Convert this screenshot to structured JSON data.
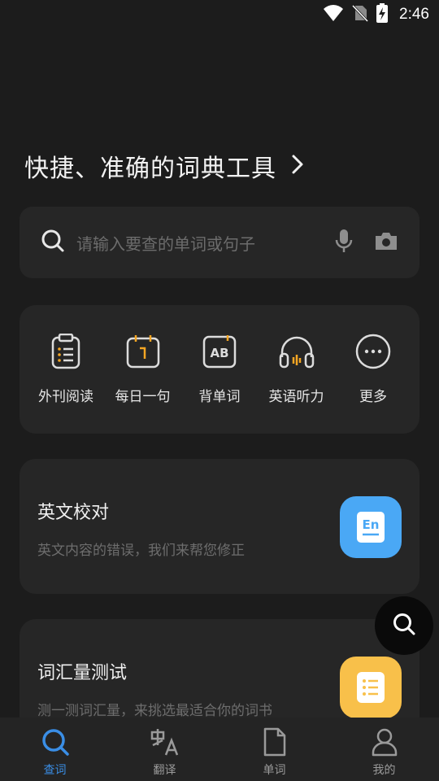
{
  "status_bar": {
    "time": "2:46",
    "icons": [
      "wifi-icon",
      "no-sim-icon",
      "battery-charging-icon"
    ]
  },
  "headline": {
    "text": "快捷、准确的词典工具",
    "icon": "chevron-right-icon"
  },
  "search": {
    "placeholder": "请输入要查的单词或句子",
    "icons": [
      "search-icon",
      "microphone-icon",
      "camera-icon"
    ]
  },
  "tools": [
    {
      "label": "外刊阅读",
      "icon": "clipboard-list-icon"
    },
    {
      "label": "每日一句",
      "icon": "calendar-icon"
    },
    {
      "label": "背单词",
      "icon": "ab-card-icon"
    },
    {
      "label": "英语听力",
      "icon": "headphones-icon"
    },
    {
      "label": "更多",
      "icon": "more-dots-icon"
    }
  ],
  "features": [
    {
      "title": "英文校对",
      "subtitle": "英文内容的错误，我们来帮您修正",
      "icon": "en-icon",
      "icon_text": "En",
      "icon_color": "#4aa8f5"
    },
    {
      "title": "词汇量测试",
      "subtitle": "测一测词汇量，来挑选最适合你的词书",
      "icon": "list-icon",
      "icon_color": "#f8c04a"
    }
  ],
  "fab": {
    "icon": "search-icon"
  },
  "bottom_nav": [
    {
      "label": "查词",
      "icon": "search-icon",
      "active": true
    },
    {
      "label": "翻译",
      "icon": "translate-icon",
      "active": false
    },
    {
      "label": "单词",
      "icon": "document-icon",
      "active": false
    },
    {
      "label": "我的",
      "icon": "user-icon",
      "active": false
    }
  ],
  "colors": {
    "background": "#1c1c1c",
    "card": "#262626",
    "accent": "#3a8ee6",
    "en_badge": "#4aa8f5",
    "list_badge": "#f8c04a",
    "listening_accent": "#f5a623"
  }
}
